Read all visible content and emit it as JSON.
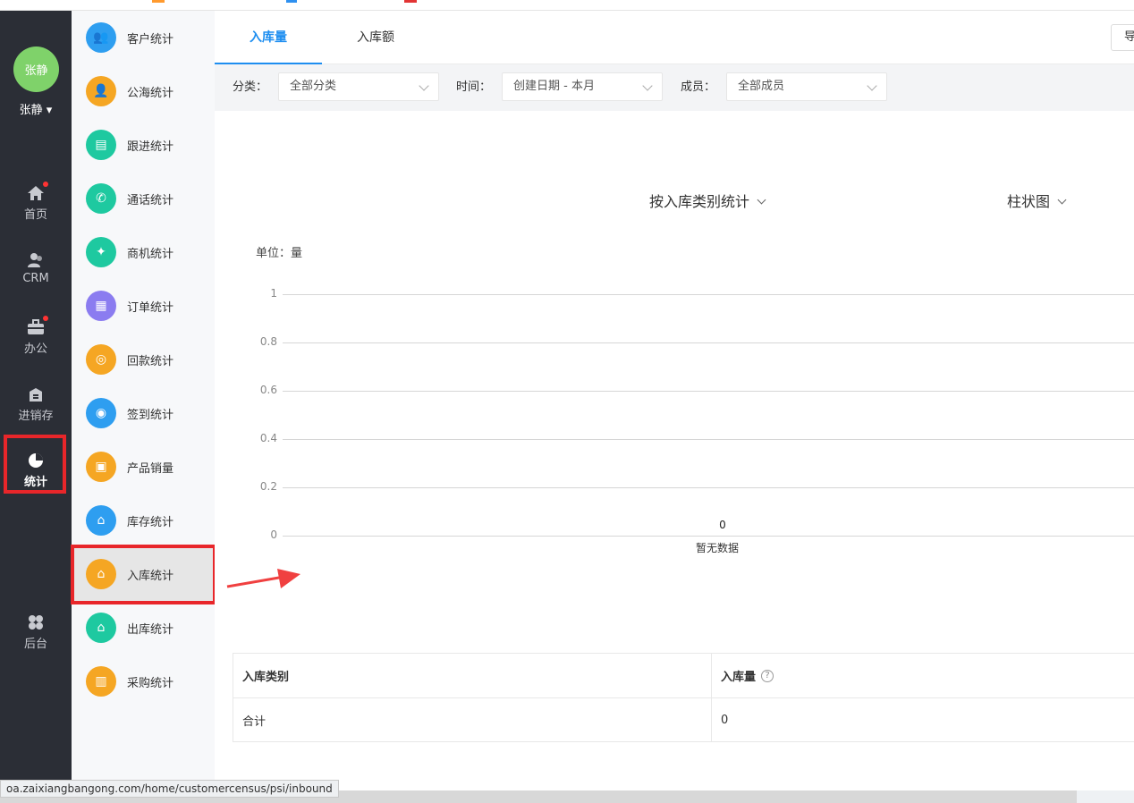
{
  "topbar": {
    "accents": [
      "#ff9a2e",
      "#2e90f0",
      "#e23434"
    ]
  },
  "user": {
    "avatar_text": "张静",
    "name": "张静 ▾"
  },
  "leftnav": [
    {
      "label": "首页",
      "icon": "home-icon",
      "badge": true
    },
    {
      "label": "CRM",
      "icon": "people-icon",
      "badge": false
    },
    {
      "label": "办公",
      "icon": "briefcase-icon",
      "badge": true
    },
    {
      "label": "进销存",
      "icon": "warehouse-icon",
      "badge": false
    },
    {
      "label": "统计",
      "icon": "pie-chart-icon",
      "badge": false,
      "active": true
    },
    {
      "label": "后台",
      "icon": "grid-icon",
      "badge": false
    }
  ],
  "subnav": [
    {
      "label": "客户统计",
      "color": "#2e9ef0",
      "glyph": "👥"
    },
    {
      "label": "公海统计",
      "color": "#f5a623",
      "glyph": "👤"
    },
    {
      "label": "跟进统计",
      "color": "#1ec9a0",
      "glyph": "▤"
    },
    {
      "label": "通话统计",
      "color": "#1ec9a0",
      "glyph": "✆"
    },
    {
      "label": "商机统计",
      "color": "#1ec9a0",
      "glyph": "✦"
    },
    {
      "label": "订单统计",
      "color": "#8b7cf0",
      "glyph": "▦"
    },
    {
      "label": "回款统计",
      "color": "#f5a623",
      "glyph": "◎"
    },
    {
      "label": "签到统计",
      "color": "#2e9ef0",
      "glyph": "◉"
    },
    {
      "label": "产品销量",
      "color": "#f5a623",
      "glyph": "▣"
    },
    {
      "label": "库存统计",
      "color": "#2e9ef0",
      "glyph": "⌂"
    },
    {
      "label": "入库统计",
      "color": "#f5a623",
      "glyph": "⌂",
      "active": true
    },
    {
      "label": "出库统计",
      "color": "#1ec9a0",
      "glyph": "⌂"
    },
    {
      "label": "采购统计",
      "color": "#f5a623",
      "glyph": "▥"
    }
  ],
  "tabs": [
    {
      "label": "入库量",
      "active": true
    },
    {
      "label": "入库额",
      "active": false
    }
  ],
  "export_label": "导",
  "filters": {
    "category_label": "分类：",
    "category_value": "全部分类",
    "time_label": "时间：",
    "time_value": "创建日期 - 本月",
    "member_label": "成员：",
    "member_value": "全部成员"
  },
  "chart_controls": {
    "group_by": "按入库类别统计",
    "chart_type": "柱状图"
  },
  "chart_data": {
    "type": "bar",
    "title": "",
    "ylabel": "单位：量",
    "xlabel": "",
    "ylim": [
      0,
      1
    ],
    "yticks": [
      "1",
      "0.8",
      "0.6",
      "0.4",
      "0.2",
      "0"
    ],
    "categories": [
      "暂无数据"
    ],
    "values": [
      0
    ],
    "data_labels": [
      "0"
    ],
    "grid": true
  },
  "table": {
    "headers": [
      "入库类别",
      "入库量"
    ],
    "help_icon": "?",
    "rows": [
      [
        "合计",
        "0"
      ]
    ]
  },
  "status_url": "oa.zaixiangbangong.com/home/customercensus/psi/inbound"
}
